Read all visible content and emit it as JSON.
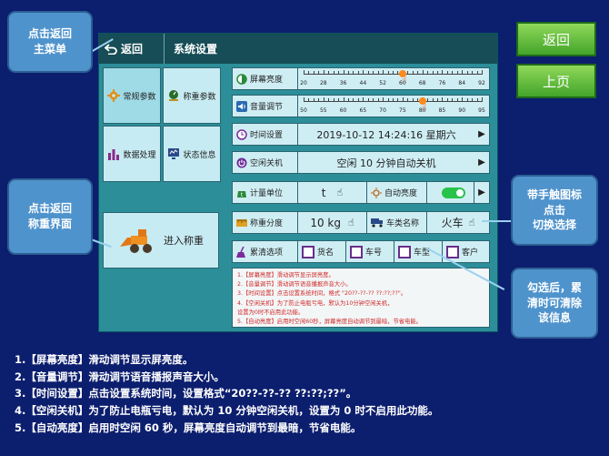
{
  "title_bar": {
    "back_label": "返回",
    "title": "系统设置"
  },
  "menu": {
    "general": "常规参数",
    "weighing_params": "称重参数",
    "data_processing": "数据处理",
    "status_info": "状态信息",
    "enter_weighing": "进入称重"
  },
  "settings": {
    "brightness": {
      "label": "屏幕亮度",
      "ticks": [
        "20",
        "28",
        "36",
        "44",
        "52",
        "60",
        "68",
        "76",
        "84",
        "92"
      ],
      "level": 60
    },
    "volume": {
      "label": "音量调节",
      "ticks": [
        "50",
        "55",
        "60",
        "65",
        "70",
        "75",
        "80",
        "85",
        "90",
        "95"
      ],
      "level": 80
    },
    "time": {
      "label": "时间设置",
      "value": "2019-10-12 14:24:16 星期六"
    },
    "idle_off": {
      "label": "空闲关机",
      "value": "空闲 10 分钟自动关机"
    },
    "unit": {
      "label": "计量单位",
      "value": "t"
    },
    "auto_brightness": {
      "label": "自动亮度",
      "enabled": true
    },
    "division": {
      "label": "称重分度",
      "value": "10 kg"
    },
    "vehicle_type": {
      "label": "车类名称",
      "value": "火车"
    },
    "clear_options": {
      "label": "累清选项",
      "options": [
        "货名",
        "车号",
        "车型",
        "客户"
      ]
    }
  },
  "help_box": [
    "1.【屏幕亮度】滑动调节显示屏亮度。",
    "2.【音量调节】滑动调节语音播报声音大小。",
    "3.【时间设置】点击设置系统时间，格式 \"20??-??-?? ??:??;??\"。",
    "4.【空闲关机】为了防止电瓶亏电，默认为10分钟空闲关机，",
    "设置为0时不启用此功能。",
    "5.【自动亮度】启用时空闲60秒，屏幕亮度自动调节到最暗，节省电能。"
  ],
  "side_buttons": {
    "back": "返回",
    "prev_page": "上页"
  },
  "callouts": {
    "main_menu": [
      "点击返回",
      "主菜单"
    ],
    "weigh_screen": [
      "点击返回",
      "称重界面"
    ],
    "touch_icon": [
      "带手触图标",
      "点击",
      "切换选择"
    ],
    "checkbox_hint": [
      "勾选后，累",
      "清时可清除",
      "该信息"
    ]
  },
  "bottom_notes": [
    "1.【屏幕亮度】滑动调节显示屏亮度。",
    "2.【音量调节】滑动调节语音播报声音大小。",
    "3.【时间设置】点击设置系统时间，设置格式“20??-??-?? ??:??;??”。",
    "4.【空闲关机】为了防止电瓶亏电，默认为 10 分钟空闲关机，设置为 0 时不启用此功能。",
    "5.【自动亮度】启用时空闲 60 秒，屏幕亮度自动调节到最暗，节省电能。"
  ],
  "colors": {
    "background": "#0c1e6e",
    "screen": "#2c8e99",
    "title_bar": "#174d56",
    "accent_green": "#43a52a",
    "callout": "#4f93cc",
    "help_text": "#d02a2a"
  }
}
